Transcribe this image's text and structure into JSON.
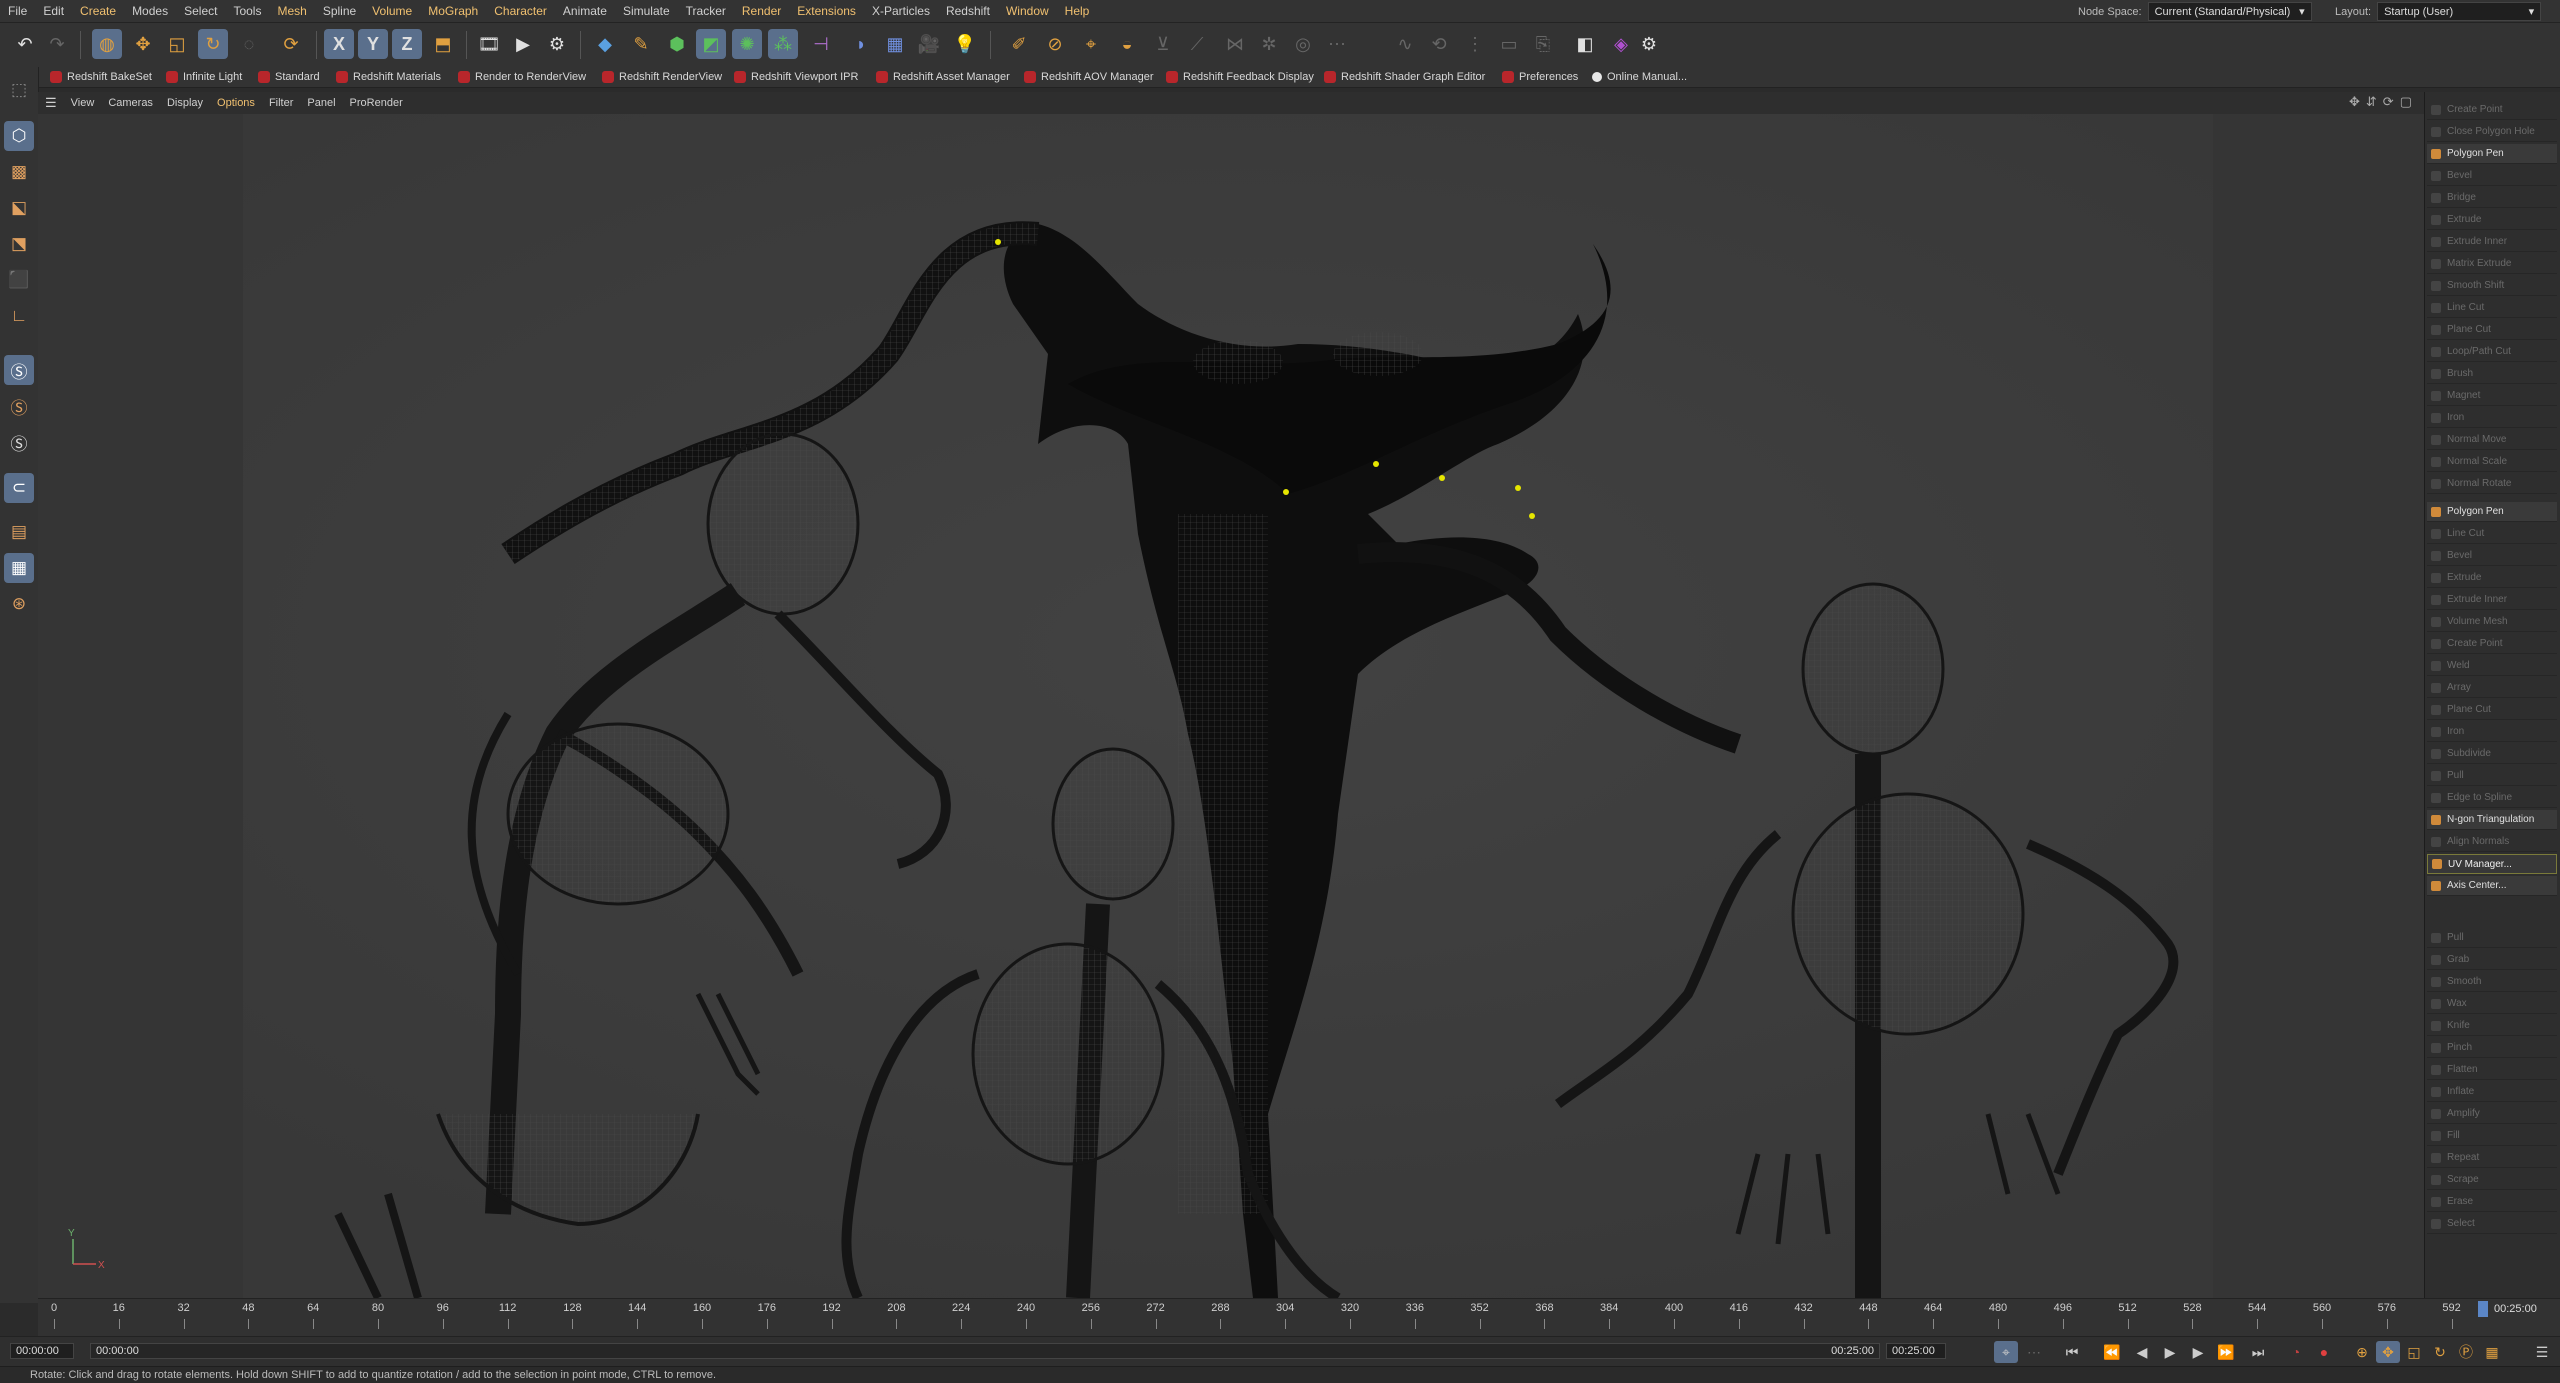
{
  "menubar": {
    "items": [
      "File",
      "Edit",
      "Create",
      "Modes",
      "Select",
      "Tools",
      "Mesh",
      "Spline",
      "Volume",
      "MoGraph",
      "Character",
      "Animate",
      "Simulate",
      "Tracker",
      "Render",
      "Extensions",
      "X-Particles",
      "Redshift",
      "Window",
      "Help"
    ],
    "node_space_label": "Node Space:",
    "node_space_value": "Current (Standard/Physical)",
    "layout_label": "Layout:",
    "layout_value": "Startup (User)"
  },
  "toolbar": {
    "axis_x": "X",
    "axis_y": "Y",
    "axis_z": "Z"
  },
  "pluginbar": {
    "items": [
      "Redshift BakeSet",
      "Infinite Light",
      "Standard",
      "Redshift Materials",
      "Render to RenderView",
      "Redshift RenderView",
      "Redshift Viewport IPR",
      "Redshift Asset Manager",
      "Redshift AOV Manager",
      "Redshift Feedback Display",
      "Redshift Shader Graph Editor",
      "Preferences",
      "Online Manual..."
    ]
  },
  "viewport_menu": {
    "items": [
      "View",
      "Cameras",
      "Display",
      "Options",
      "Filter",
      "Panel",
      "ProRender"
    ]
  },
  "commands": {
    "group1": [
      "Create Point",
      "Close Polygon Hole",
      "Polygon Pen",
      "Bevel",
      "Bridge",
      "Extrude",
      "Extrude Inner",
      "Matrix Extrude",
      "Smooth Shift",
      "Line Cut",
      "Plane Cut",
      "Loop/Path Cut",
      "Brush",
      "Magnet",
      "Iron",
      "Normal Move",
      "Normal Scale",
      "Normal Rotate"
    ],
    "group2": [
      "Polygon Pen",
      "Line Cut",
      "Bevel",
      "Extrude",
      "Extrude Inner",
      "Volume Mesh",
      "Create Point",
      "Weld",
      "Array",
      "Plane Cut",
      "Iron",
      "Subdivide",
      "Pull",
      "Edge to Spline",
      "N-gon Triangulation",
      "Align Normals",
      "UV Manager...",
      "Axis Center..."
    ],
    "group3": [
      "Pull",
      "Grab",
      "Smooth",
      "Wax",
      "Knife",
      "Pinch",
      "Flatten",
      "Inflate",
      "Amplify",
      "Fill",
      "Repeat",
      "Scrape",
      "Erase",
      "Select"
    ]
  },
  "timeline": {
    "ticks": [
      "0",
      "16",
      "32",
      "48",
      "64",
      "80",
      "96",
      "112",
      "128",
      "144",
      "160",
      "176",
      "192",
      "208",
      "224",
      "240",
      "256",
      "272",
      "288",
      "304",
      "320",
      "336",
      "352",
      "368",
      "384",
      "400",
      "416",
      "432",
      "448",
      "464",
      "480",
      "496",
      "512",
      "528",
      "544",
      "560",
      "576",
      "592"
    ],
    "end_frame": "00:25:00"
  },
  "playbar": {
    "current_time": "00:00:00",
    "start_time": "00:00:00",
    "end_time": "00:25:00",
    "end_time2": "00:25:00"
  },
  "status": {
    "text": "Rotate: Click and drag to rotate elements. Hold down SHIFT to add to quantize rotation / add to the selection in point mode, CTRL to remove."
  },
  "axis": {
    "y": "Y",
    "x": "X"
  }
}
